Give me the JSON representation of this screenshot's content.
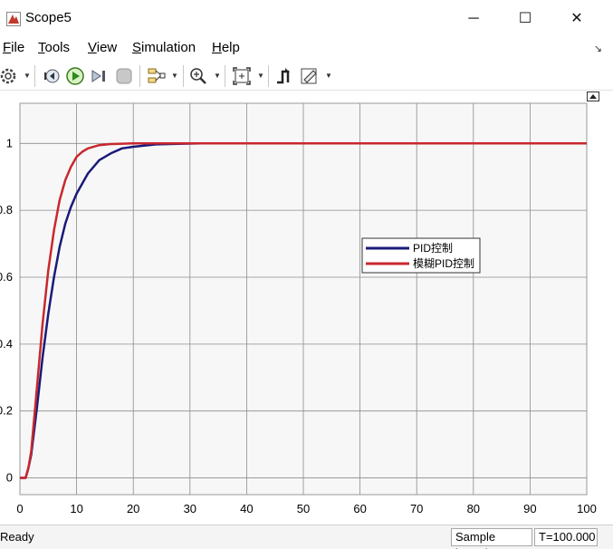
{
  "window": {
    "title": "Scope5",
    "buttons": {
      "minimize": "─",
      "maximize": "☐",
      "close": "✕"
    }
  },
  "menu": [
    {
      "label": "File",
      "mnemonic": "F",
      "rest": "ile"
    },
    {
      "label": "Tools",
      "mnemonic": "T",
      "rest": "ools"
    },
    {
      "label": "View",
      "mnemonic": "V",
      "rest": "iew"
    },
    {
      "label": "Simulation",
      "mnemonic": "S",
      "rest": "imulation"
    },
    {
      "label": "Help",
      "mnemonic": "H",
      "rest": "elp"
    }
  ],
  "toolbar": {
    "icons": [
      "settings-icon",
      "step-back-icon",
      "run-icon",
      "step-forward-icon",
      "stop-icon",
      "signal-select-icon",
      "zoom-icon",
      "fit-to-view-icon",
      "triggers-icon",
      "edit-style-icon"
    ]
  },
  "chart_data": {
    "type": "line",
    "xlim": [
      0,
      100
    ],
    "ylim": [
      -0.05,
      1.12
    ],
    "x_ticks": [
      "0",
      "10",
      "20",
      "30",
      "40",
      "50",
      "60",
      "70",
      "80",
      "90",
      "100"
    ],
    "y_ticks": [
      "0",
      "0.2",
      "0.4",
      "0.6",
      "0.8",
      "1"
    ],
    "x_tick_values": [
      0,
      10,
      20,
      30,
      40,
      50,
      60,
      70,
      80,
      90,
      100
    ],
    "y_tick_values": [
      0,
      0.2,
      0.4,
      0.6,
      0.8,
      1
    ],
    "grid": true,
    "legend_position": "center-right",
    "series": [
      {
        "name": "PID控制",
        "color": "#1a1a7a",
        "x": [
          0,
          1,
          1.5,
          2,
          3,
          4,
          5,
          6,
          7,
          8,
          9,
          10,
          12,
          14,
          16,
          18,
          20,
          24,
          28,
          32,
          40,
          60,
          80,
          100
        ],
        "y": [
          0,
          0,
          0.03,
          0.07,
          0.21,
          0.36,
          0.49,
          0.6,
          0.69,
          0.76,
          0.81,
          0.85,
          0.91,
          0.95,
          0.97,
          0.985,
          0.99,
          0.997,
          0.999,
          1,
          1,
          1,
          1,
          1
        ]
      },
      {
        "name": "模糊PID控制",
        "color": "#c8282e",
        "x": [
          0,
          1,
          1.5,
          2,
          3,
          4,
          5,
          6,
          7,
          8,
          9,
          10,
          11,
          12,
          14,
          16,
          20,
          25,
          30,
          40,
          60,
          80,
          100
        ],
        "y": [
          0,
          0,
          0.03,
          0.08,
          0.27,
          0.46,
          0.62,
          0.74,
          0.83,
          0.89,
          0.93,
          0.96,
          0.975,
          0.985,
          0.995,
          0.998,
          1,
          1,
          1,
          1,
          1,
          1,
          1
        ]
      }
    ]
  },
  "status": {
    "text": "Ready",
    "mode": "Sample based",
    "time": "T=100.000"
  }
}
